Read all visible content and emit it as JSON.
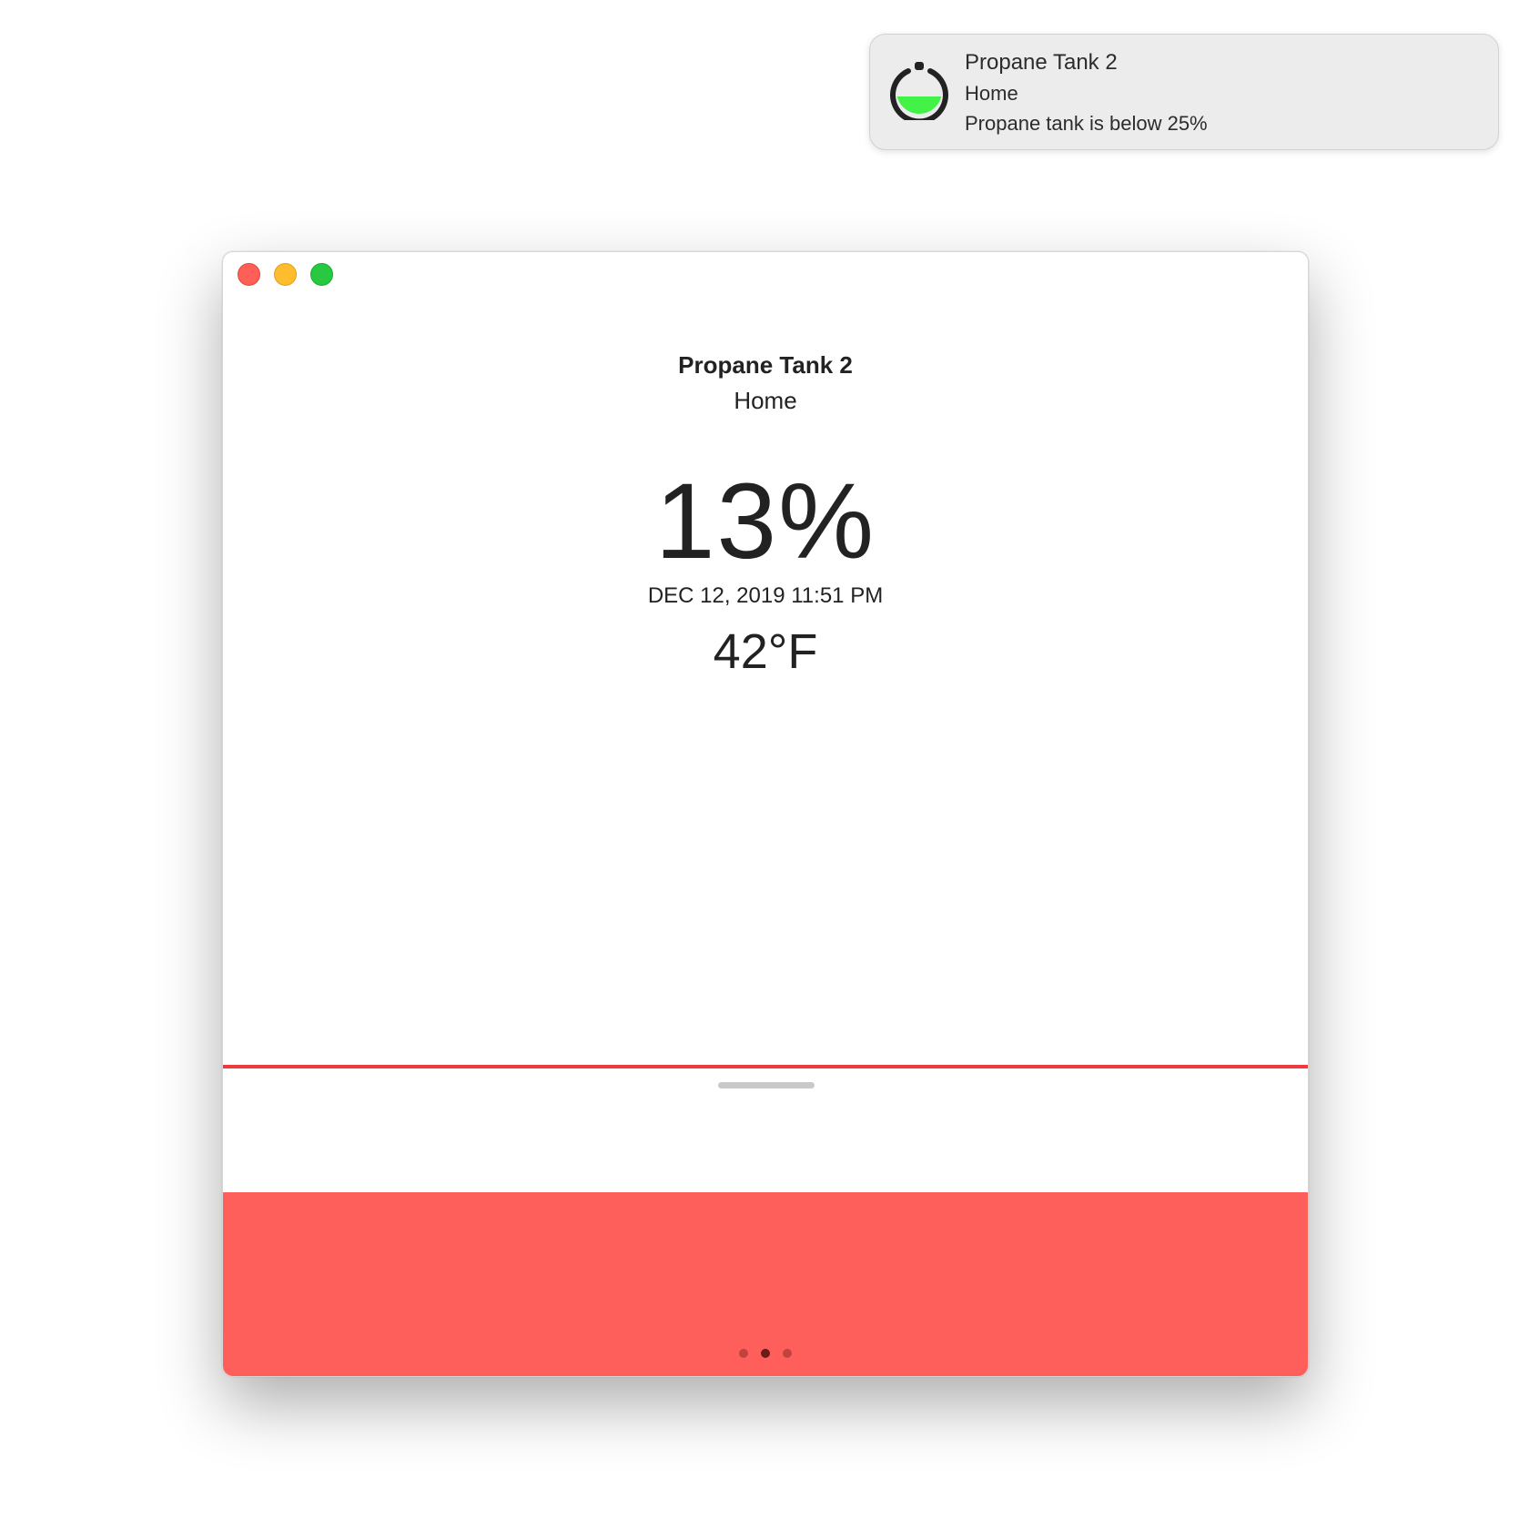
{
  "notification": {
    "title": "Propane Tank 2",
    "subtitle": "Home",
    "body": "Propane tank is below 25%",
    "icon": "propane-tank-icon"
  },
  "window": {
    "controls": [
      "close",
      "minimize",
      "zoom"
    ]
  },
  "device": {
    "name": "Propane Tank 2",
    "location": "Home",
    "level": "13%",
    "level_fraction": 0.13,
    "timestamp": "DEC 12, 2019 11:51 PM",
    "temperature": "42°F"
  },
  "pager": {
    "count": 3,
    "active_index": 1
  },
  "colors": {
    "fill": "#fe5f5b",
    "level_line": "#ee3b3b",
    "icon_fill": "#43f247"
  }
}
